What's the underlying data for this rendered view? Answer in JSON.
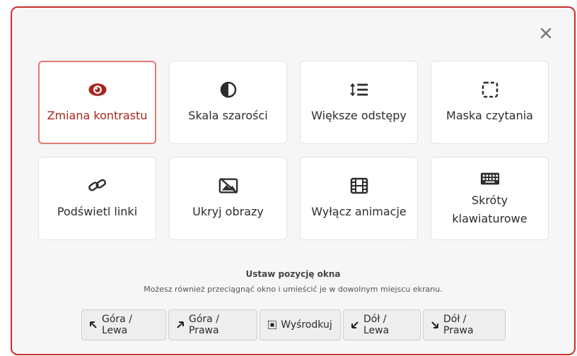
{
  "modal": {
    "close_label": "×",
    "accent": "#c9302c"
  },
  "tiles": [
    {
      "label": "Zmiana kontrastu",
      "icon": "eye-icon",
      "active": true
    },
    {
      "label": "Skala szarości",
      "icon": "contrast-half-circle-icon",
      "active": false
    },
    {
      "label": "Większe odstępy",
      "icon": "line-spacing-icon",
      "active": false
    },
    {
      "label": "Maska czytania",
      "icon": "dashed-square-icon",
      "active": false
    },
    {
      "label": "Podświetl linki",
      "icon": "link-icon",
      "active": false
    },
    {
      "label": "Ukryj obrazy",
      "icon": "hidden-image-icon",
      "active": false
    },
    {
      "label": "Wyłącz animacje",
      "icon": "film-icon",
      "active": false
    },
    {
      "label": "Skróty klawiaturowe",
      "icon": "keyboard-icon",
      "active": false
    }
  ],
  "position": {
    "title": "Ustaw pozycję okna",
    "description": "Możesz również przeciągnąć okno i umieścić je w dowolnym miejscu ekranu.",
    "buttons": [
      {
        "label": "Góra / Lewa",
        "icon": "arrow-up-left-icon"
      },
      {
        "label": "Góra / Prawa",
        "icon": "arrow-up-right-icon"
      },
      {
        "label": "Wyśrodkuj",
        "icon": "center-grid-icon"
      },
      {
        "label": "Dół / Lewa",
        "icon": "arrow-down-left-icon"
      },
      {
        "label": "Dół / Prawa",
        "icon": "arrow-down-right-icon"
      }
    ]
  }
}
